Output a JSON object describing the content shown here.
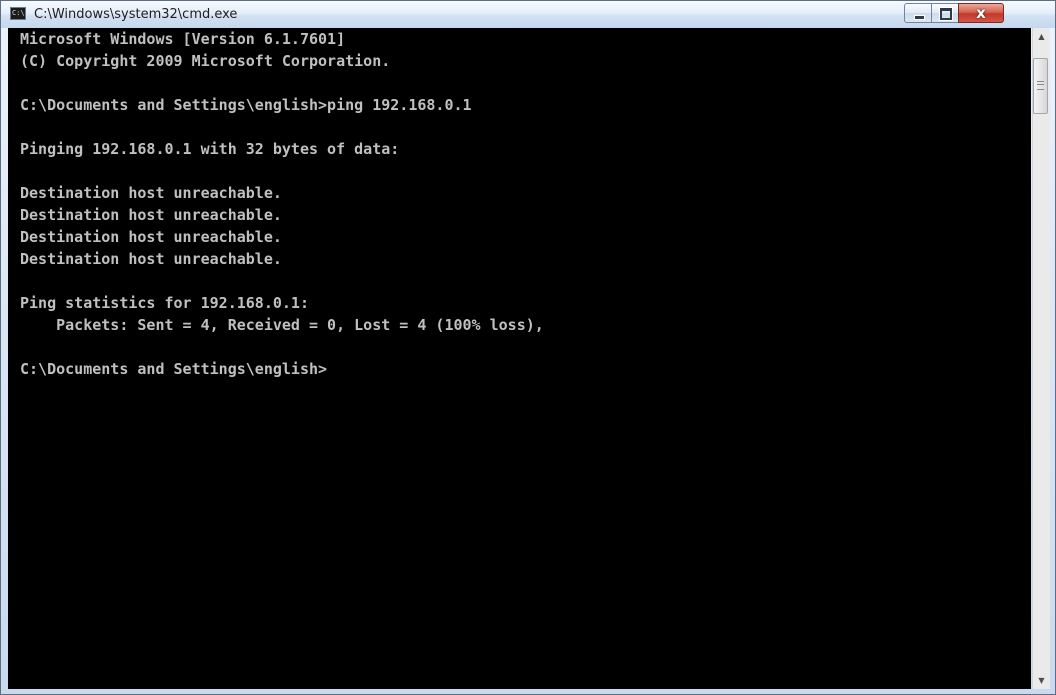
{
  "window": {
    "title": "C:\\Windows\\system32\\cmd.exe",
    "icon": "cmd-app-icon",
    "icon_text": "C:\\",
    "minimize_icon": "minimize-icon",
    "maximize_icon": "maximize-icon",
    "close_label": "x"
  },
  "console": {
    "lines": [
      "Microsoft Windows [Version 6.1.7601]",
      "(C) Copyright 2009 Microsoft Corporation.",
      "C:\\Documents and Settings\\english>ping 192.168.0.1",
      "Pinging 192.168.0.1 with 32 bytes of data:",
      "Destination host unreachable.",
      "Destination host unreachable.",
      "Destination host unreachable.",
      "Destination host unreachable.",
      "Ping statistics for 192.168.0.1:",
      "    Packets: Sent = 4, Received = 0, Lost = 4 (100% loss),",
      "C:\\Documents and Settings\\english>"
    ]
  },
  "scrollbar": {
    "up_arrow": "▲",
    "down_arrow": "▼",
    "thumb_grip_icon": "grip-lines-icon"
  }
}
